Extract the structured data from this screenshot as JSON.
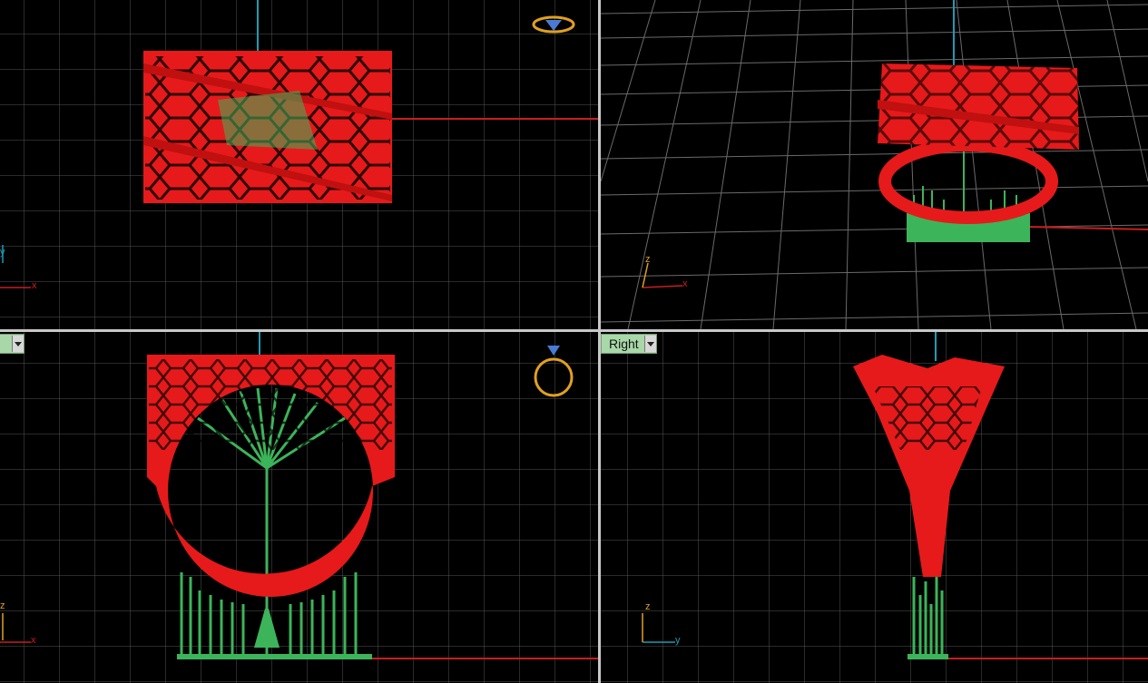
{
  "viewports": {
    "front_label": "",
    "right_label": "Right"
  },
  "axis_labels": {
    "x": "x",
    "y": "y",
    "z": "z"
  },
  "colors": {
    "background": "#000000",
    "grid": "#5a5a5a",
    "x_axis": "#c81e1e",
    "y_axis": "#1e9bb4",
    "ring_model": "#e61a1a",
    "supports": "#3cb45a",
    "widget": "#e0a020",
    "label_bg": "#a8d8a8"
  },
  "icons": {
    "top_widget": "diamond-ring-top-view-icon",
    "front_widget": "diamond-ring-front-view-icon",
    "dropdown": "chevron-down-icon"
  }
}
